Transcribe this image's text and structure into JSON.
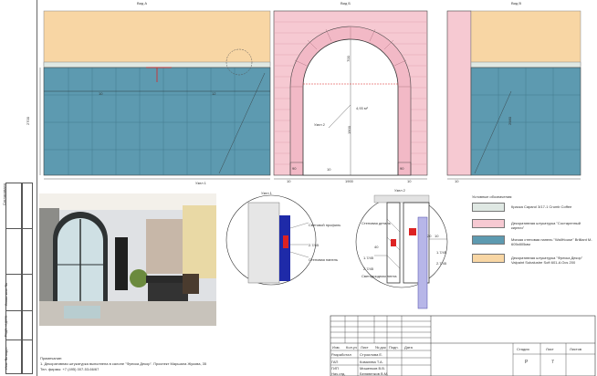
{
  "views": {
    "a": {
      "title": "Вид А"
    },
    "b": {
      "title": "Вид Б"
    },
    "c": {
      "title": "Вид В"
    }
  },
  "dims": {
    "a_height": "2700",
    "a_mid": "10",
    "a_right": "12",
    "b_width": "1900",
    "b_left": "10",
    "b_right": "10",
    "b_area": "4,93 м²",
    "b_mid": "10",
    "b_90_left": "90",
    "b_90_right": "90",
    "b_height_top": "700",
    "b_height_main": "1900",
    "c_height": "2980",
    "c_left": "10"
  },
  "nodes": {
    "node1_label": "Узел 1",
    "node2_label": "Узел 2",
    "node1_title": "Узел 1",
    "node2_title": "Узел 2"
  },
  "node1": {
    "profile": "Световой профиль",
    "wall": "Стеновая панель",
    "level1": "2.7/45",
    "level2": "2.7/45"
  },
  "node2": {
    "wall_lbl": "Стеновая деталь",
    "light_lbl": "Светодиодная лента",
    "d1": "20",
    "d2": "10",
    "d3": "40",
    "l1": "1.7/45",
    "l2": "2.7/45",
    "l3": "1.7/45",
    "l4": "2.7/45"
  },
  "legend": {
    "title": "Условные обозначения:",
    "items": [
      {
        "text": "Краска Caparol 3/17-1 Crumb Coffee",
        "color": "#dfe8e3"
      },
      {
        "text": "Декоративная штукатурка \"Состаренный кирпич\"",
        "color": "#f6c9d2"
      },
      {
        "text": "Мягкая стеновая панель \"WallHouse\" Brilliant M-605x805мм",
        "color": "#5d9ab0"
      },
      {
        "text": "Декоративная штукатурка \"Фреска Декор\" Valpaint Subalustre Soft 601-A Ocs 200",
        "color": "#f8d6a4"
      }
    ]
  },
  "notes": {
    "head": "Примечание:",
    "l1": "1. Декоративная штукатурка выполнена в салоне \"Фреска Декор\". Проспект Маршала Жукова, 35",
    "l2": "Тел. фирмы: +7 (495) 007-53-66/67"
  },
  "sidebar": {
    "s1": "Согласовано",
    "s2": "Взам. инв. №",
    "s3": "Подп. и дата",
    "s4": "Инв. № подл."
  },
  "title_block": {
    "head": [
      "Изм.",
      "Кол.уч",
      "Лист",
      "№ док",
      "Подп.",
      "Дата"
    ],
    "rows": [
      {
        "role": "Разработал",
        "name": "Строилова Е."
      },
      {
        "role": "ГАП",
        "name": "Ковалева Т.А."
      },
      {
        "role": "ГИП",
        "name": "Мишенков В.В."
      },
      {
        "role": "Нач.отд.",
        "name": "Белявенков В.М."
      }
    ],
    "stage_h": "Стадия",
    "sheet_h": "Лист",
    "sheets_h": "Листов",
    "stage": "Р",
    "sheet": "7"
  }
}
